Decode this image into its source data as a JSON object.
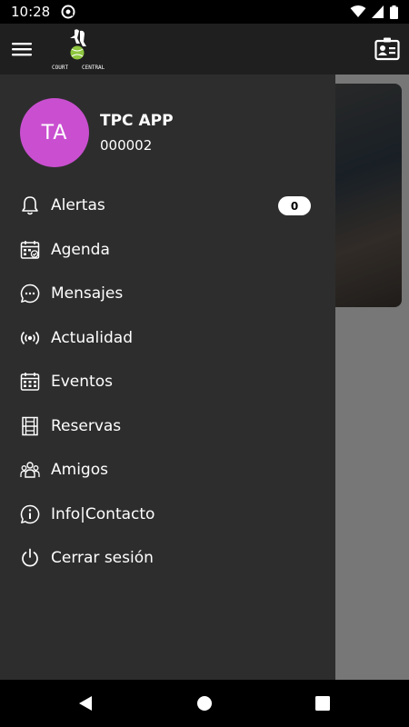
{
  "status_bar": {
    "time": "10:28",
    "icons": [
      "at-sign-icon",
      "wifi-icon",
      "signal-icon",
      "battery-icon"
    ]
  },
  "app_bar": {
    "logo_text": "COURT CENTRAL",
    "icons": [
      "hamburger-menu-icon",
      "contact-card-icon"
    ]
  },
  "profile": {
    "initials": "TA",
    "name": "TPC APP",
    "id": "000002",
    "avatar_color": "#c94fd0"
  },
  "menu": {
    "items": [
      {
        "label": "Alertas",
        "icon": "bell-icon",
        "badge": "0"
      },
      {
        "label": "Agenda",
        "icon": "calendar-check-icon"
      },
      {
        "label": "Mensajes",
        "icon": "chat-bubble-icon"
      },
      {
        "label": "Actualidad",
        "icon": "broadcast-icon"
      },
      {
        "label": "Eventos",
        "icon": "calendar-grid-icon"
      },
      {
        "label": "Reservas",
        "icon": "court-icon"
      },
      {
        "label": "Amigos",
        "icon": "people-icon"
      },
      {
        "label": "Info|Contacto",
        "icon": "info-icon"
      },
      {
        "label": "Cerrar sesión",
        "icon": "power-icon"
      }
    ]
  },
  "nav_bar": {
    "icons": [
      "back-icon",
      "home-icon",
      "recents-icon"
    ]
  }
}
